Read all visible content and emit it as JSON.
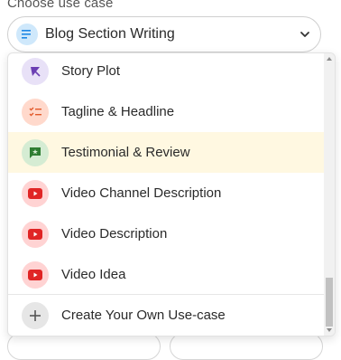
{
  "label": "Choose use case",
  "select": {
    "value": "Blog Section Writing",
    "icon": "lines-icon",
    "icon_bg": "#cfe8fb",
    "icon_color": "#1e88e5"
  },
  "dropdown": {
    "items": [
      {
        "label": "Story Plot",
        "icon": "quill-icon",
        "bg": "#e8e1f7",
        "color": "#6b3fb3"
      },
      {
        "label": "Tagline & Headline",
        "icon": "checklist-icon",
        "bg": "#ffd9cc",
        "color": "#e25a2b"
      },
      {
        "label": "Testimonial & Review",
        "icon": "review-icon",
        "bg": "#d5ecd3",
        "color": "#2e7d32",
        "highlighted": true
      },
      {
        "label": "Video Channel Description",
        "icon": "youtube-icon",
        "bg": "#ffd3d3",
        "color": "#e02525"
      },
      {
        "label": "Video Description",
        "icon": "youtube-icon",
        "bg": "#ffd3d3",
        "color": "#e02525"
      },
      {
        "label": "Video Idea",
        "icon": "youtube-icon",
        "bg": "#ffd3d3",
        "color": "#e02525"
      }
    ],
    "create": {
      "label": "Create Your Own Use-case",
      "icon": "plus-icon",
      "bg": "#e6e6e6",
      "color": "#555555"
    }
  },
  "highlight_color": "#fff8e1"
}
